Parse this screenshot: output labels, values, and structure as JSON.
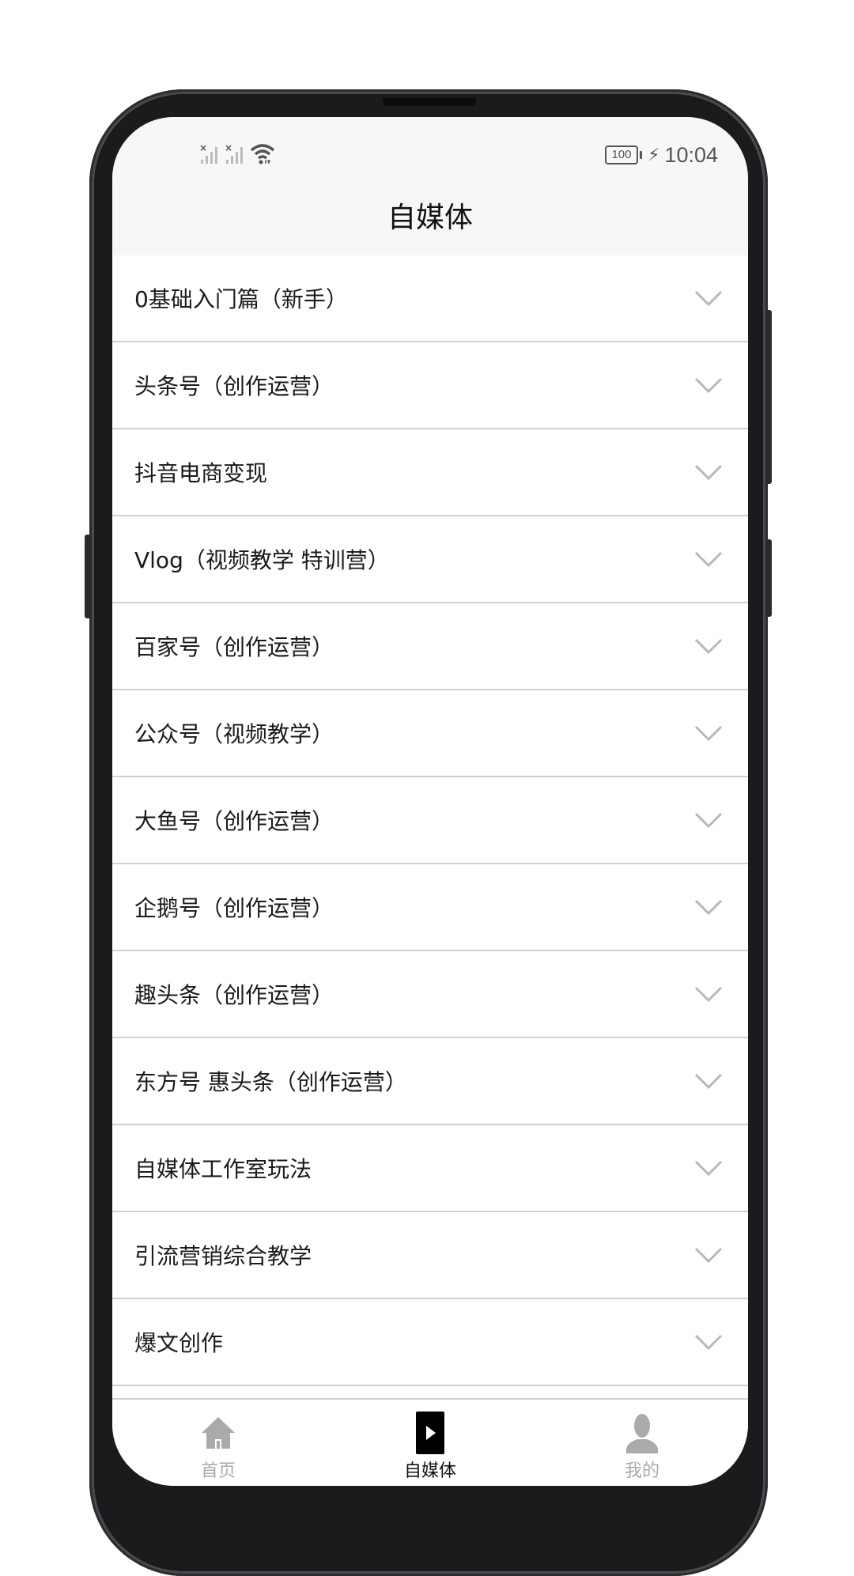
{
  "status_bar": {
    "signal_1": "no-signal",
    "signal_2": "no-signal",
    "wifi": "wifi-4g",
    "battery_level": "100",
    "charging": true,
    "time": "10:04"
  },
  "header": {
    "title": "自媒体"
  },
  "list": {
    "items": [
      {
        "label": "0基础入门篇（新手）",
        "expanded": false
      },
      {
        "label": "头条号（创作运营）",
        "expanded": false
      },
      {
        "label": "抖音电商变现",
        "expanded": false
      },
      {
        "label": "Vlog（视频教学 特训营）",
        "expanded": false
      },
      {
        "label": "百家号（创作运营）",
        "expanded": false
      },
      {
        "label": "公众号（视频教学）",
        "expanded": false
      },
      {
        "label": "大鱼号（创作运营）",
        "expanded": false
      },
      {
        "label": "企鹅号（创作运营）",
        "expanded": false
      },
      {
        "label": "趣头条（创作运营）",
        "expanded": false
      },
      {
        "label": "东方号 惠头条（创作运营）",
        "expanded": false
      },
      {
        "label": "自媒体工作室玩法",
        "expanded": false
      },
      {
        "label": "引流营销综合教学",
        "expanded": false
      },
      {
        "label": "爆文创作",
        "expanded": false
      }
    ]
  },
  "tabbar": {
    "tabs": [
      {
        "label": "首页",
        "icon": "home-icon",
        "active": false
      },
      {
        "label": "自媒体",
        "icon": "play-icon",
        "active": true
      },
      {
        "label": "我的",
        "icon": "user-icon",
        "active": false
      }
    ]
  },
  "colors": {
    "header_bg": "#f7f7f9",
    "divider": "#d0d0d3",
    "chevron": "#b8b8bb",
    "tab_inactive": "#aaaaaa",
    "tab_active": "#111111"
  }
}
